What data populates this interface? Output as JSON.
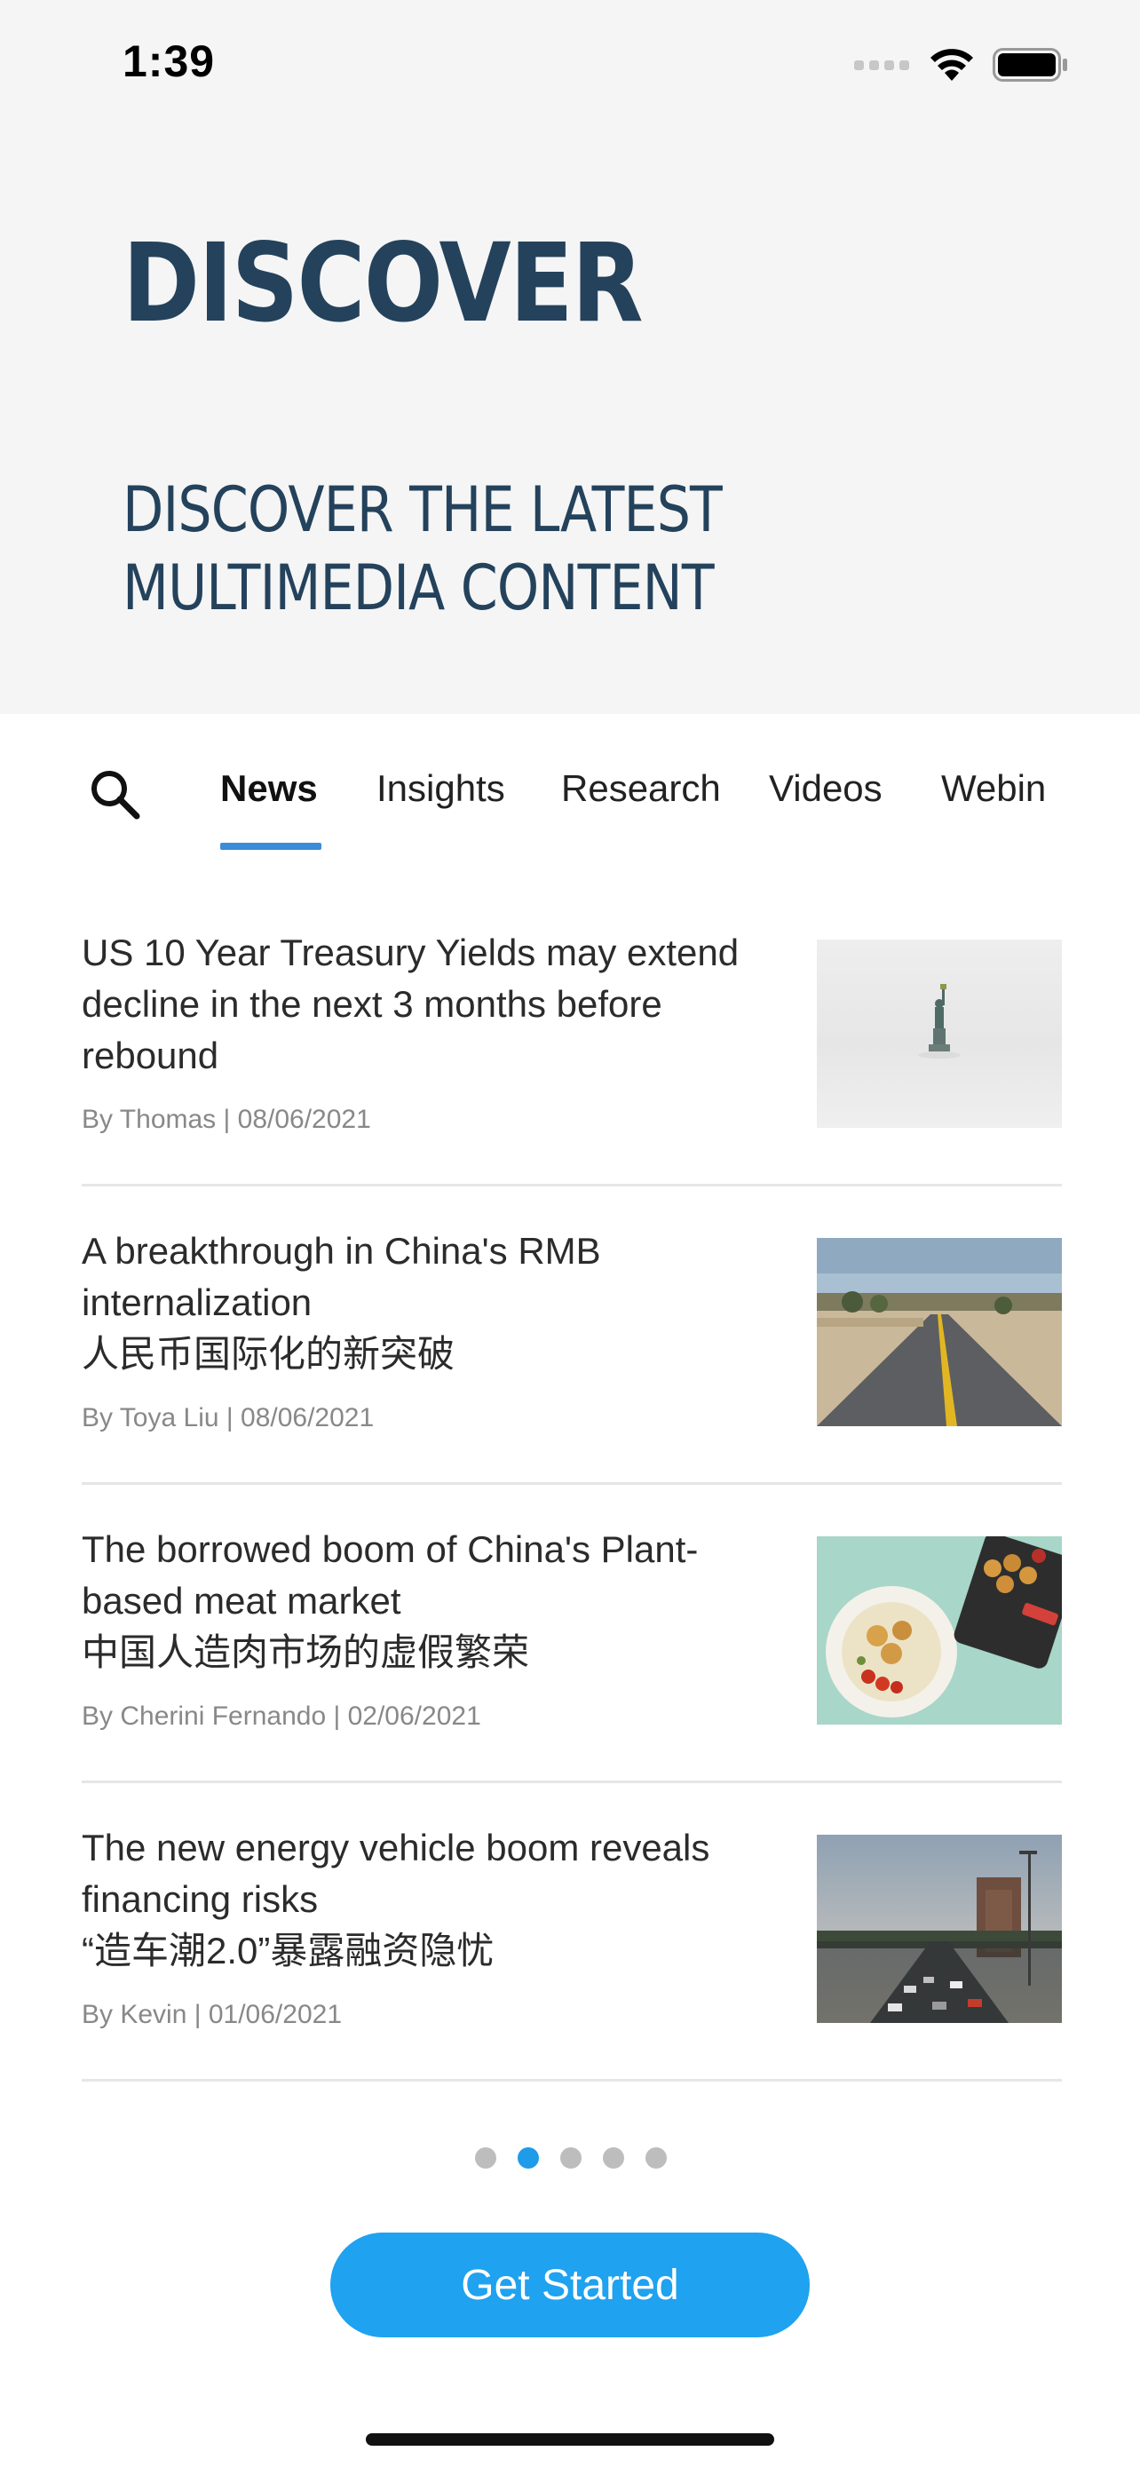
{
  "status_bar": {
    "time": "1:39"
  },
  "hero": {
    "title": "DISCOVER",
    "subtitle_lines": [
      "DISCOVER THE LATEST",
      "MULTIMEDIA CONTENT"
    ]
  },
  "tabs": [
    {
      "label": "News",
      "active": true
    },
    {
      "label": "Insights",
      "active": false
    },
    {
      "label": "Research",
      "active": false
    },
    {
      "label": "Videos",
      "active": false
    },
    {
      "label": "Webin",
      "active": false
    }
  ],
  "articles": [
    {
      "title_lines": [
        "US 10 Year Treasury Yields may extend",
        "decline in the next 3 months before",
        "rebound"
      ],
      "meta": "By Thomas | 08/06/2021",
      "thumb": "statue-of-liberty-in-fog"
    },
    {
      "title_lines": [
        "A breakthrough in China's RMB",
        "internalization",
        "人民币国际化的新突破"
      ],
      "meta": "By Toya Liu | 08/06/2021",
      "thumb": "desert-highway"
    },
    {
      "title_lines": [
        "The borrowed boom of China's Plant-",
        "based meat market",
        "中国人造肉市场的虚假繁荣"
      ],
      "meta": "By Cherini Fernando | 02/06/2021",
      "thumb": "plant-based-nuggets-plate"
    },
    {
      "title_lines": [
        "The new energy vehicle boom reveals",
        "financing risks",
        "“造车潮2.0”暴露融资隐忧"
      ],
      "meta": "By Kevin | 01/06/2021",
      "thumb": "city-traffic-road"
    }
  ],
  "pagination": {
    "count": 5,
    "active_index": 1
  },
  "cta": {
    "label": "Get Started"
  },
  "colors": {
    "hero_bg": "#f5f5f5",
    "title": "#24425c",
    "accent": "#1fa2ef",
    "tab_underline": "#3d8bd9"
  }
}
